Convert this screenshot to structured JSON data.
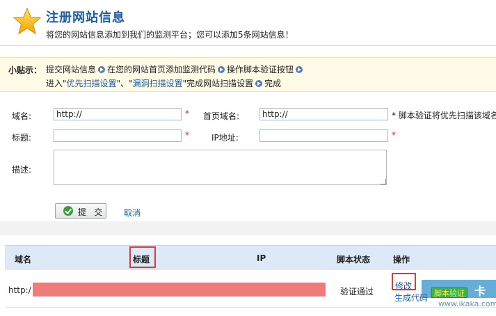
{
  "header": {
    "title": "注册网站信息",
    "subtitle": "将您的网站信息添加到我们的监测平台；您可以添加5条网站信息！",
    "icon": "star-icon"
  },
  "tips": {
    "title": "小贴示：",
    "line1": [
      "提交网站信息",
      "在您的网站首页添加监测代码",
      "操作脚本验证按钮"
    ],
    "line2_prefix": "进入\"",
    "line2_link1": "优先扫描设置",
    "line2_mid": "\"、\"",
    "line2_link2": "漏洞扫描设置",
    "line2_suffix": "\"完成网站扫描设置",
    "line2_end": "完成"
  },
  "form": {
    "domain_label": "域名:",
    "domain_value": "http://",
    "home_label": "首页域名:",
    "home_value": "http://",
    "home_note": "* 脚本验证将优先扫描该域名",
    "title_label": "标题:",
    "title_value": "",
    "ip_label": "IP地址:",
    "ip_value": "",
    "desc_label": "描述:",
    "desc_value": "",
    "required_mark": "*",
    "submit_label": "提 交",
    "cancel_label": "取消"
  },
  "table": {
    "columns": [
      "域名",
      "标题",
      "IP",
      "脚本状态",
      "操作"
    ],
    "rows": [
      {
        "domain": "http:/",
        "status": "验证通过",
        "edit": "修改",
        "code": "生成代码",
        "verify": "脚本验证"
      }
    ]
  },
  "watermark": {
    "text": "卡",
    "url": "www.ikaka.com"
  },
  "colors": {
    "accent": "#1b5aa6",
    "required": "#d22222",
    "highlight": "#d93a3a",
    "redact": "#f07b7b"
  }
}
